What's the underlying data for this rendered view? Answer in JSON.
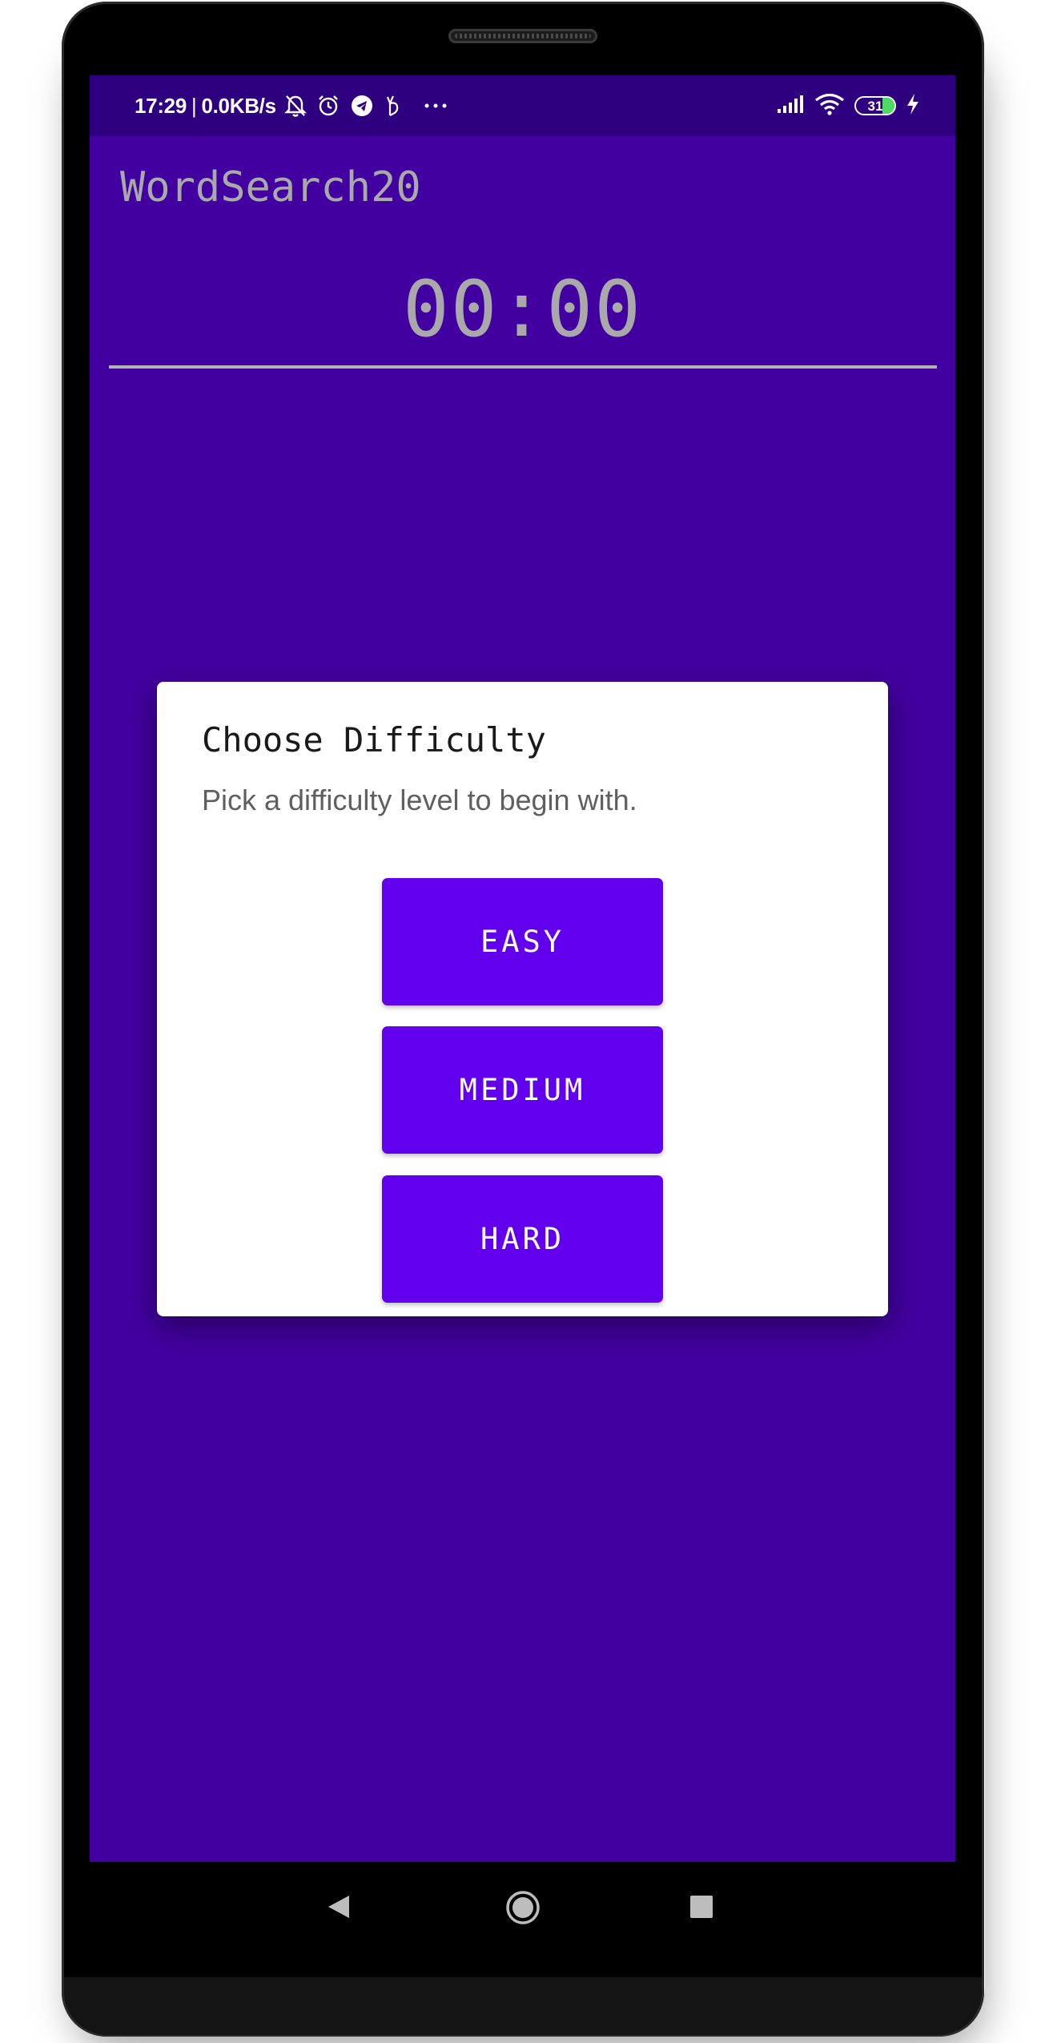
{
  "status_bar": {
    "time": "17:29",
    "separator": "|",
    "net_speed": "0.0KB/s",
    "left_icons": [
      "bell-off-icon",
      "alarm-icon",
      "telegram-icon",
      "gesture-icon",
      "more-dots-icon"
    ],
    "right_icons": [
      "signal-icon",
      "wifi-icon",
      "battery-icon",
      "charging-icon"
    ],
    "battery_level": "31",
    "battery_fill_fraction": 0.31
  },
  "app": {
    "title": "WordSearch20",
    "timer": "00:00"
  },
  "dialog": {
    "title": "Choose Difficulty",
    "message": "Pick a difficulty level to begin with.",
    "buttons": {
      "easy": "EASY",
      "medium": "MEDIUM",
      "hard": "HARD"
    }
  },
  "nav_bar": {
    "icons": [
      "back-icon",
      "home-icon",
      "recents-icon"
    ]
  },
  "colors": {
    "app_background": "#4200a0",
    "status_bar": "#2e0080",
    "button": "#6200ee",
    "dialog": "#ffffff",
    "muted_text": "#a9a9a9"
  }
}
